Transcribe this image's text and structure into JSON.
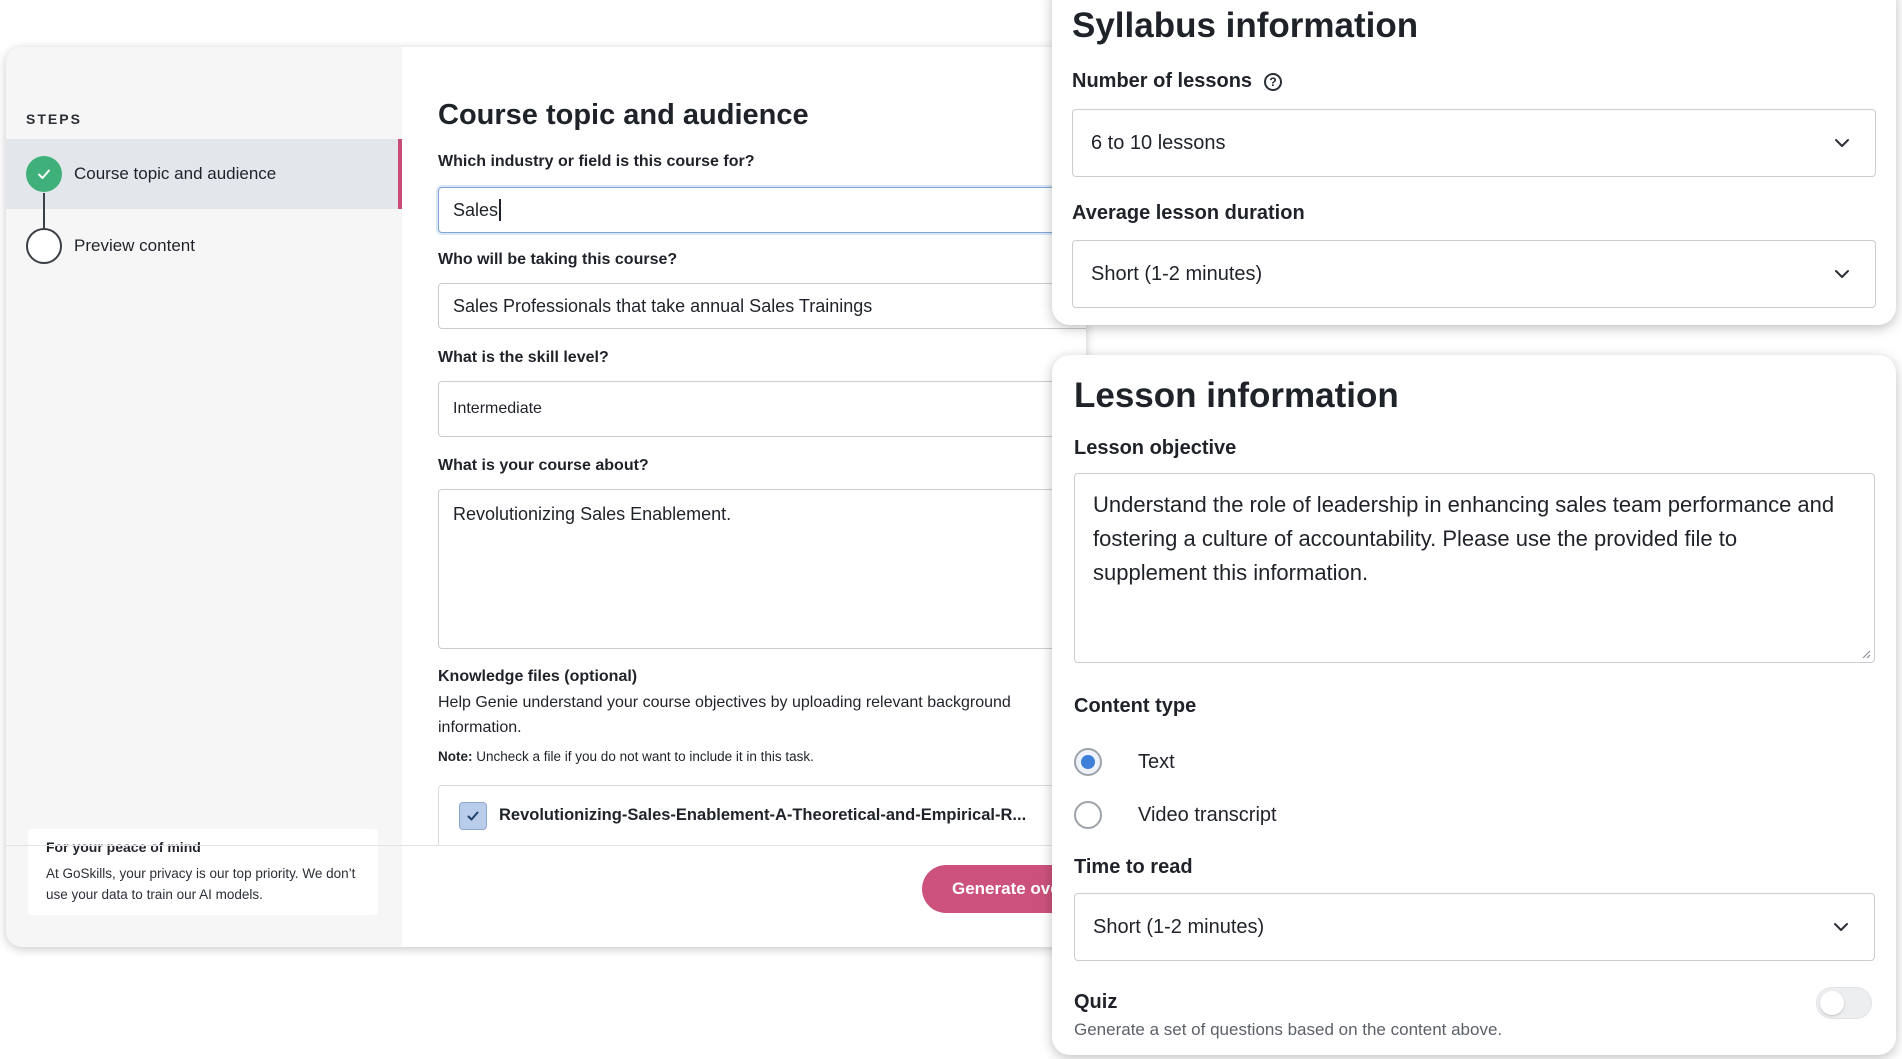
{
  "sidebar": {
    "steps_heading": "STEPS",
    "steps": [
      {
        "label": "Course topic and audience",
        "state": "completed"
      },
      {
        "label": "Preview content",
        "state": "pending"
      }
    ],
    "privacy": {
      "title": "For your peace of mind",
      "text": "At GoSkills, your privacy is our top priority. We don’t use your data to train our AI models."
    }
  },
  "main": {
    "title": "Course topic and audience",
    "industry": {
      "label": "Which industry or field is this course for?",
      "value": "Sales"
    },
    "audience": {
      "label": "Who will be taking this course?",
      "value": "Sales Professionals that take annual Sales Trainings"
    },
    "skill": {
      "label": "What is the skill level?",
      "value": "Intermediate"
    },
    "about": {
      "label": "What is your course about?",
      "value": "Revolutionizing Sales Enablement."
    },
    "knowledge": {
      "label": "Knowledge files (optional)",
      "help": "Help Genie understand your course objectives by uploading relevant background information.",
      "note_prefix": "Note:",
      "note": " Uncheck a file if you do not want to include it in this task.",
      "file_name": "Revolutionizing-Sales-Enablement-A-Theoretical-and-Empirical-R...",
      "file_checked": true
    },
    "generate_label": "Generate ove"
  },
  "syllabus": {
    "title": "Syllabus information",
    "lessons_label": "Number of lessons",
    "lessons_value": "6 to 10 lessons",
    "duration_label": "Average lesson duration",
    "duration_value": "Short (1-2 minutes)"
  },
  "lesson": {
    "title": "Lesson information",
    "objective_label": "Lesson objective",
    "objective_value": "Understand the role of leadership in enhancing sales team performance and fostering a culture of accountability. Please use the provided file to supplement this information.",
    "content_type_label": "Content type",
    "content_types": [
      {
        "label": "Text",
        "selected": true
      },
      {
        "label": "Video transcript",
        "selected": false
      }
    ],
    "time_label": "Time to read",
    "time_value": "Short (1-2 minutes)",
    "quiz_label": "Quiz",
    "quiz_desc": "Generate a set of questions based on the content above.",
    "quiz_enabled": false
  },
  "colors": {
    "accent": "#cc527d",
    "success": "#3fb07a",
    "radio": "#3d7fd9"
  }
}
